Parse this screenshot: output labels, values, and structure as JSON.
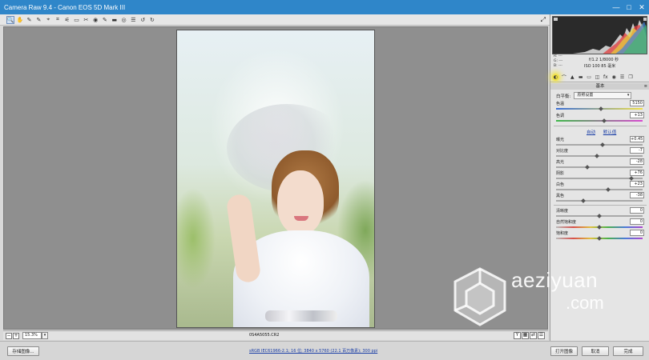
{
  "window": {
    "title": "Camera Raw 9.4 -  Canon EOS 5D Mark III",
    "minimize": "—",
    "maximize": "□",
    "close": "✕"
  },
  "toolbar": {
    "tools": [
      "zoom-tool",
      "hand-tool",
      "white-balance-tool",
      "color-sampler-tool",
      "targeted-adjustment-tool",
      "crop-tool",
      "straighten-tool",
      "transform-tool",
      "spot-removal-tool",
      "red-eye-tool",
      "adjustment-brush-tool",
      "graduated-filter-tool",
      "radial-filter-tool",
      "preferences",
      "rotate-ccw",
      "rotate-cw"
    ],
    "tool_glyphs": [
      "🔍",
      "✋",
      "✎",
      "✎",
      "⌖",
      "⌗",
      "⚟",
      "▭",
      "✂",
      "◉",
      "✎",
      "▬",
      "◎",
      "☰",
      "↺",
      "↻"
    ],
    "fullscreen_glyph": "⤢"
  },
  "status": {
    "zoom_value": "15.3%",
    "filename": "0S4A5055.CR2"
  },
  "bottom": {
    "save_label": "存储图像...",
    "workflow_link": "sRGB IEC61966-2.1; 16 位; 3840 x 5760 (22.1 百万像素); 300 ppi",
    "open_label": "打开图像",
    "cancel_label": "取消",
    "done_label": "完成"
  },
  "camera_info": {
    "r_label": "R: ---",
    "g_label": "G: ---",
    "b_label": "B: ---",
    "exposure": "f/1.2   1/8000 秒",
    "iso_lens": "ISO 100   85 毫米"
  },
  "panel": {
    "section_title": "基本",
    "white_balance_label": "白平衡:",
    "white_balance_value": "原照设置",
    "links": [
      "自动",
      "默认值"
    ],
    "sliders": [
      {
        "label": "色温",
        "value": "5150",
        "pos": 0.52
      },
      {
        "label": "色调",
        "value": "+13",
        "pos": 0.56
      },
      {
        "label": "曝光",
        "value": "+0.45",
        "pos": 0.54
      },
      {
        "label": "对比度",
        "value": "-7",
        "pos": 0.47
      },
      {
        "label": "高光",
        "value": "-28",
        "pos": 0.36
      },
      {
        "label": "阴影",
        "value": "+76",
        "pos": 0.88
      },
      {
        "label": "白色",
        "value": "+23",
        "pos": 0.61
      },
      {
        "label": "黑色",
        "value": "-38",
        "pos": 0.31
      },
      {
        "label": "清晰度",
        "value": "0",
        "pos": 0.5
      },
      {
        "label": "自然饱和度",
        "value": "0",
        "pos": 0.5
      },
      {
        "label": "饱和度",
        "value": "0",
        "pos": 0.5
      }
    ]
  },
  "watermark": {
    "line1": "aeziyuan",
    "line2": ".com"
  }
}
